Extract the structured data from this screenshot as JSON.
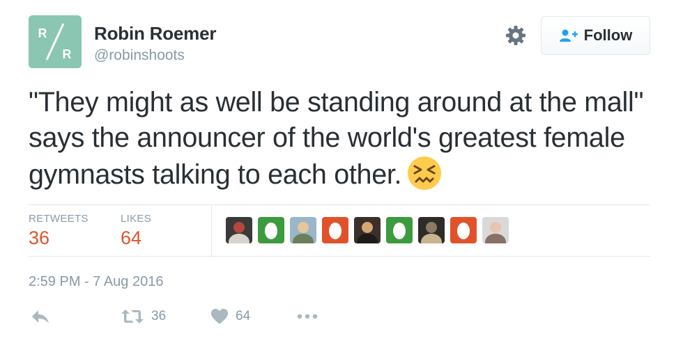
{
  "author": {
    "name": "Robin Roemer",
    "handle": "@robinshoots",
    "avatar_monogram_top": "R",
    "avatar_monogram_bottom": "R",
    "avatar_color": "#8ac6b1"
  },
  "header": {
    "follow_label": "Follow",
    "settings_icon": "gear-icon",
    "follow_icon": "add-user-icon"
  },
  "tweet": {
    "text": "\"They might as well be standing around at the mall\" says the announcer of the world's greatest female gymnasts talking to each other.",
    "emoji": "confounded-face-emoji"
  },
  "stats": {
    "retweets_label": "RETWEETS",
    "retweets_value": "36",
    "likes_label": "LIKES",
    "likes_value": "64"
  },
  "likers": [
    {
      "type": "photo",
      "palette": [
        "#3a3a3a",
        "#b8463c",
        "#d9d4cc"
      ]
    },
    {
      "type": "egg",
      "color": "#3c9b3c"
    },
    {
      "type": "photo",
      "palette": [
        "#9cb6c9",
        "#e6c79a",
        "#6b7f5a"
      ]
    },
    {
      "type": "egg",
      "color": "#e0532a"
    },
    {
      "type": "photo",
      "palette": [
        "#3b2f2a",
        "#d7a773",
        "#1d1a18"
      ]
    },
    {
      "type": "egg",
      "color": "#3c9b3c"
    },
    {
      "type": "photo",
      "palette": [
        "#2e2c29",
        "#8c7a66",
        "#c9b48f"
      ]
    },
    {
      "type": "egg",
      "color": "#e0532a"
    },
    {
      "type": "photo",
      "palette": [
        "#d9d9d9",
        "#e9c4b0",
        "#8a6f66"
      ]
    }
  ],
  "timestamp": "2:59 PM - 7 Aug 2016",
  "actions": {
    "reply_icon": "reply-icon",
    "retweet_icon": "retweet-icon",
    "retweet_count": "36",
    "like_icon": "heart-icon",
    "like_count": "64",
    "more_icon": "more-icon"
  },
  "colors": {
    "accent": "#e0532a",
    "muted": "#8899a6",
    "text": "#292f33",
    "follow_icon": "#1da1f2",
    "action_icon": "#aab8c2"
  }
}
